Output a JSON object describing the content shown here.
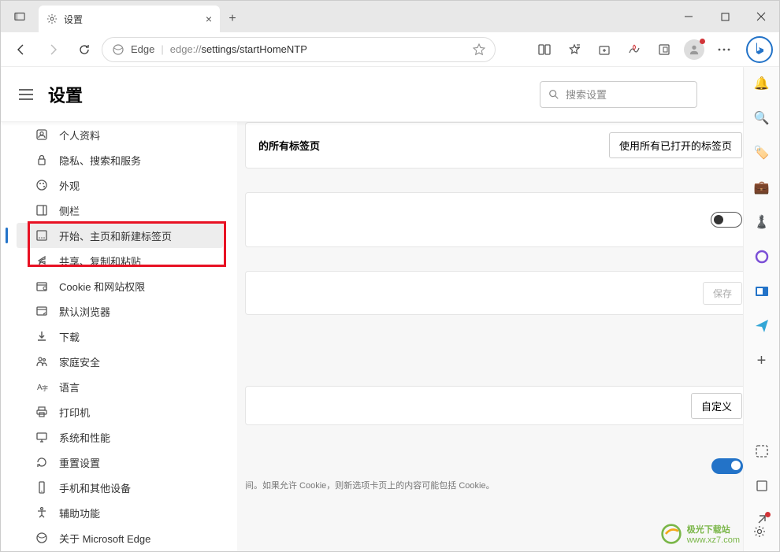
{
  "window": {
    "tab_title": "设置",
    "new_tab_tooltip": "+",
    "minimize": "—",
    "maximize": "□",
    "close": "✕"
  },
  "toolbar": {
    "edge_label": "Edge",
    "url_prefix": "edge://",
    "url_path": "settings/startHomeNTP"
  },
  "settings": {
    "title": "设置",
    "search_placeholder": "搜索设置"
  },
  "nav": {
    "items": [
      {
        "icon": "profile",
        "label": "个人资料"
      },
      {
        "icon": "lock",
        "label": "隐私、搜索和服务"
      },
      {
        "icon": "appearance",
        "label": "外观"
      },
      {
        "icon": "sidebar",
        "label": "侧栏"
      },
      {
        "icon": "start",
        "label": "开始、主页和新建标签页"
      },
      {
        "icon": "share",
        "label": "共享、复制和粘贴"
      },
      {
        "icon": "cookie",
        "label": "Cookie 和网站权限"
      },
      {
        "icon": "browser",
        "label": "默认浏览器"
      },
      {
        "icon": "download",
        "label": "下载"
      },
      {
        "icon": "family",
        "label": "家庭安全"
      },
      {
        "icon": "language",
        "label": "语言"
      },
      {
        "icon": "printer",
        "label": "打印机"
      },
      {
        "icon": "system",
        "label": "系统和性能"
      },
      {
        "icon": "reset",
        "label": "重置设置"
      },
      {
        "icon": "phone",
        "label": "手机和其他设备"
      },
      {
        "icon": "accessibility",
        "label": "辅助功能"
      },
      {
        "icon": "about",
        "label": "关于 Microsoft Edge"
      }
    ],
    "active_index": 4
  },
  "main": {
    "card1_label": "的所有标签页",
    "card1_button": "使用所有已打开的标签页",
    "save_label": "保存",
    "customize_label": "自定义",
    "cookie_text": "间。如果允许 Cookie，则新选项卡页上的内容可能包括 Cookie。"
  },
  "watermark": {
    "text1": "极光下载站",
    "text2": "www.xz7.com"
  }
}
